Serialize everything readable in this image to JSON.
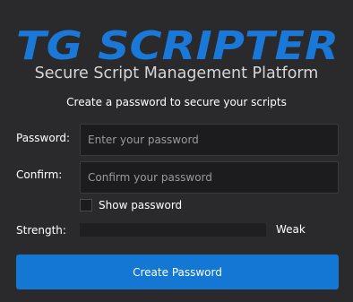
{
  "header": {
    "logo_text": "TG SCRIPTER",
    "tagline": "Secure Script Management Platform",
    "accent_color": "#1a78d8"
  },
  "form": {
    "instruction": "Create a password to secure your scripts",
    "password": {
      "label": "Password:",
      "placeholder": "Enter your password",
      "value": ""
    },
    "confirm": {
      "label": "Confirm:",
      "placeholder": "Confirm your password",
      "value": ""
    },
    "show_password": {
      "label": "Show password",
      "checked": false
    },
    "strength": {
      "label": "Strength:",
      "level_text": "Weak",
      "level_fraction": 0
    },
    "submit_label": "Create Password"
  }
}
